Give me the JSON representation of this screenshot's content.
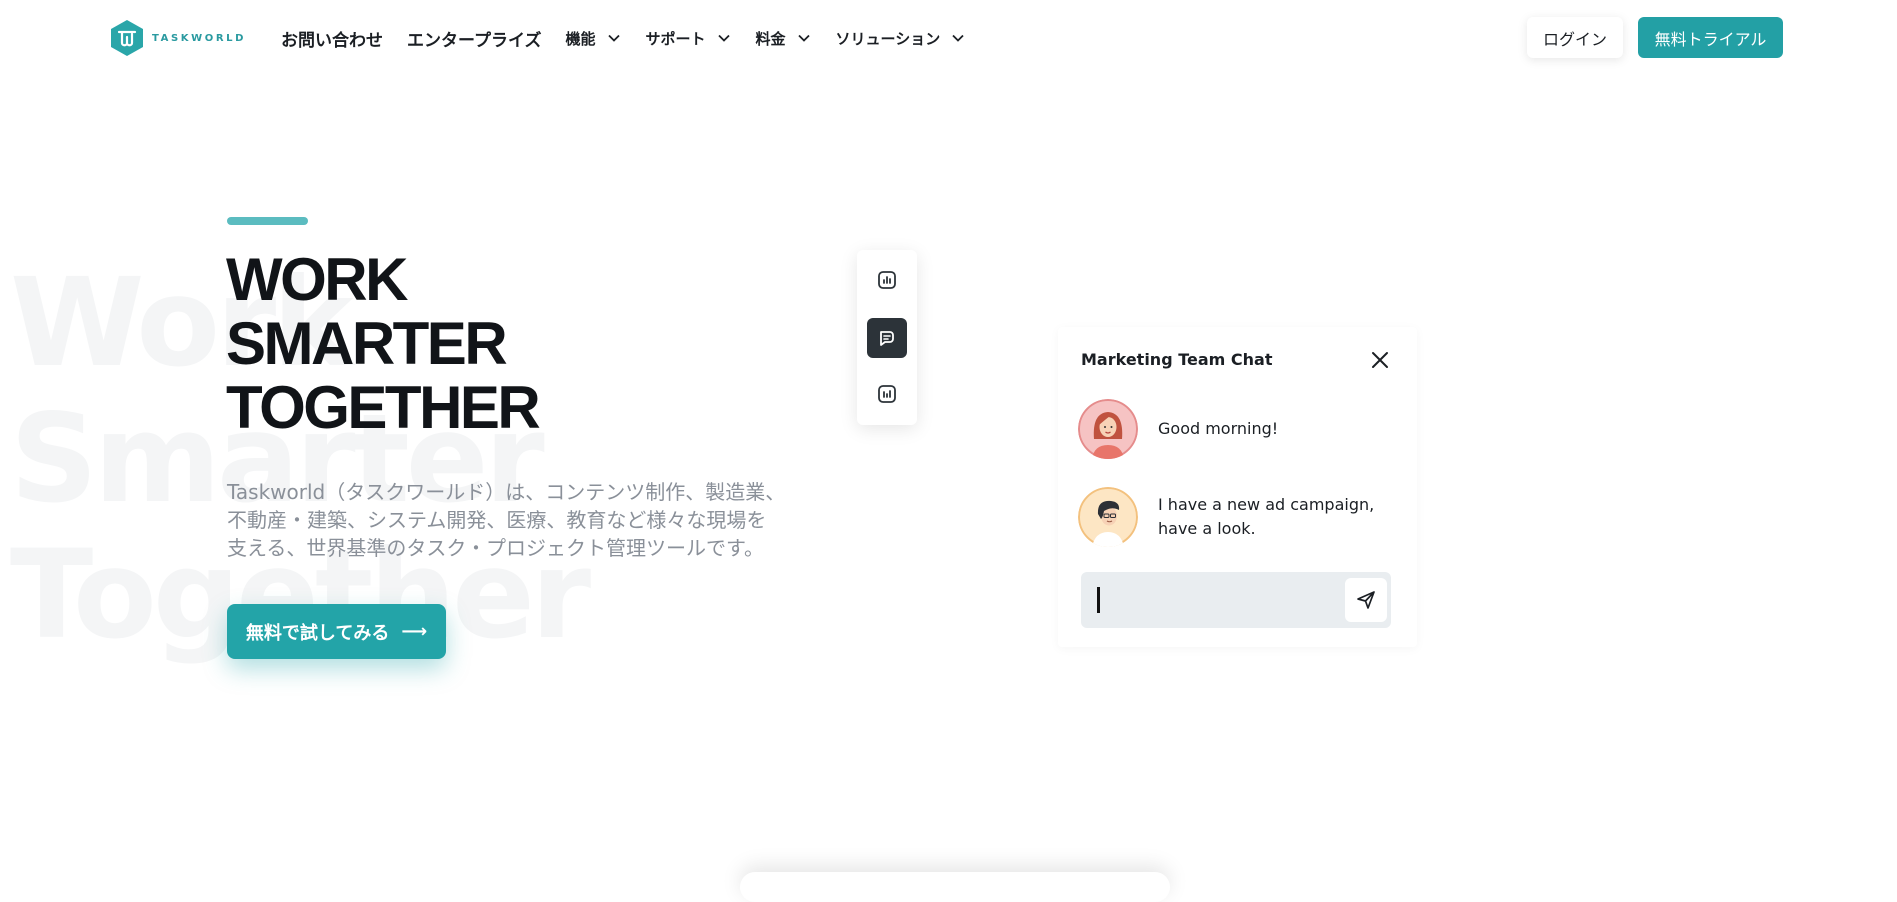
{
  "header": {
    "logo_text": "TASKWORLD",
    "nav": [
      {
        "label": "お問い合わせ",
        "dropdown": false
      },
      {
        "label": "エンタープライズ",
        "dropdown": false
      },
      {
        "label": "機能",
        "dropdown": true
      },
      {
        "label": "サポート",
        "dropdown": true
      },
      {
        "label": "料金",
        "dropdown": true
      },
      {
        "label": "ソリューション",
        "dropdown": true
      }
    ],
    "login_label": "ログイン",
    "trial_label": "無料トライアル"
  },
  "hero": {
    "background_words": [
      "Work",
      "Smarter",
      "Together"
    ],
    "headline": [
      "WORK",
      "SMARTER",
      "TOGETHER"
    ],
    "description": [
      "Taskworld（タスクワールド）は、コンテンツ制作、製造業、",
      "不動産・建築、システム開発、医療、教育など様々な現場を",
      "支える、世界基準のタスク・プロジェクト管理ツールです。"
    ],
    "cta_label": "無料で試してみる",
    "cta_arrow": "⟶"
  },
  "toolbar": {
    "items": [
      {
        "icon": "chart-icon",
        "active": false
      },
      {
        "icon": "chat-icon",
        "active": true
      },
      {
        "icon": "chart-icon",
        "active": false
      }
    ]
  },
  "chat": {
    "title": "Marketing Team Chat",
    "messages": [
      {
        "avatar": "woman-avatar",
        "text": "Good morning!"
      },
      {
        "avatar": "man-avatar",
        "text": "I have a new ad campaign, have a look."
      }
    ],
    "input_value": ""
  },
  "colors": {
    "brand": "#23a0a5",
    "accent_bar": "#5bbcc0",
    "toolbar_active": "#2c3339"
  }
}
